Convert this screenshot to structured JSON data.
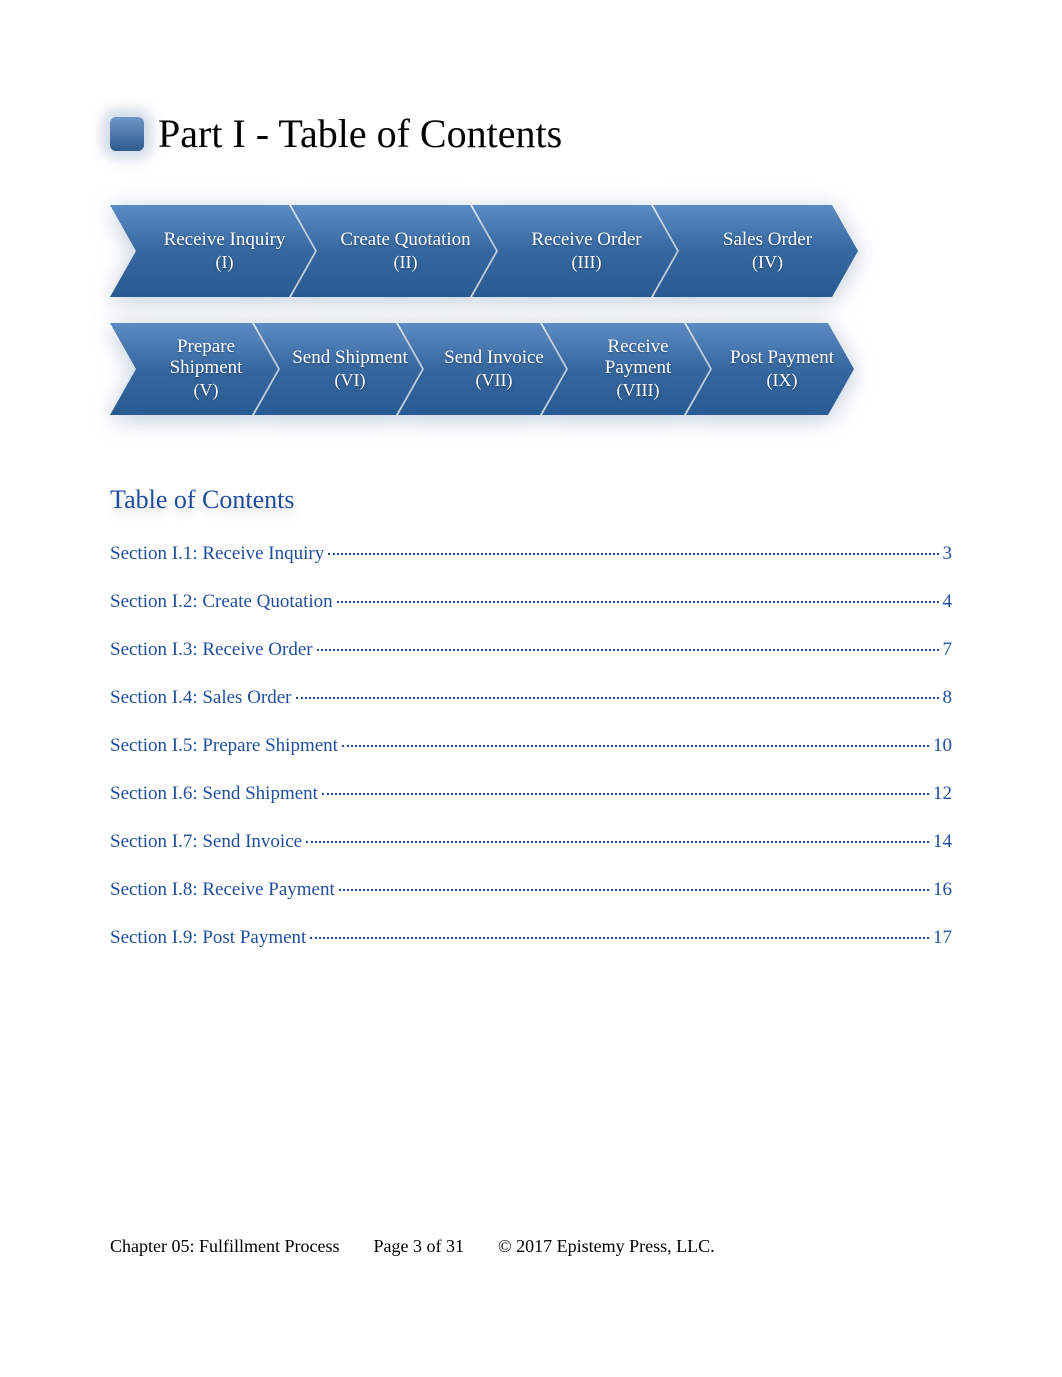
{
  "title": "Part I - Table of Contents",
  "toc_heading": "Table of Contents",
  "flow_row1": [
    {
      "label": "Receive Inquiry",
      "roman": "(I)"
    },
    {
      "label": "Create Quotation",
      "roman": "(II)"
    },
    {
      "label": "Receive Order",
      "roman": "(III)"
    },
    {
      "label": "Sales Order",
      "roman": "(IV)"
    }
  ],
  "flow_row2": [
    {
      "label": "Prepare Shipment",
      "roman": "(V)"
    },
    {
      "label": "Send Shipment",
      "roman": "(VI)"
    },
    {
      "label": "Send Invoice",
      "roman": "(VII)"
    },
    {
      "label": "Receive Payment",
      "roman": "(VIII)"
    },
    {
      "label": "Post Payment",
      "roman": "(IX)"
    }
  ],
  "toc": [
    {
      "label": "Section I.1: Receive Inquiry",
      "page": "3"
    },
    {
      "label": "Section I.2: Create Quotation",
      "page": "4"
    },
    {
      "label": "Section I.3: Receive Order",
      "page": "7"
    },
    {
      "label": "Section I.4: Sales Order",
      "page": "8"
    },
    {
      "label": "Section I.5: Prepare Shipment",
      "page": "10"
    },
    {
      "label": "Section I.6: Send Shipment",
      "page": "12"
    },
    {
      "label": "Section I.7: Send Invoice",
      "page": "14"
    },
    {
      "label": "Section I.8: Receive Payment",
      "page": "16"
    },
    {
      "label": "Section I.9: Post Payment",
      "page": "17"
    }
  ],
  "footer": {
    "chapter": "Chapter 05: Fulfillment Process",
    "page": "Page 3 of 31",
    "copyright": "© 2017 Epistemy Press, LLC."
  }
}
